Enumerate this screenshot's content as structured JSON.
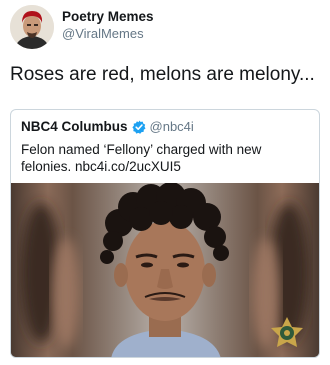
{
  "tweet": {
    "author_name": "Poetry Memes",
    "author_handle": "@ViralMemes",
    "text": "Roses are red, melons are melony..."
  },
  "quote": {
    "name": "NBC4 Columbus",
    "handle": "@nbc4i",
    "text": "Felon named ‘Fellony’ charged with new felonies. nbc4i.co/2ucXUI5",
    "verified_icon": "verified-badge-icon"
  },
  "colors": {
    "text": "#14171a",
    "secondary": "#657786",
    "border": "#ccd6dd",
    "verified": "#1da1f2"
  }
}
